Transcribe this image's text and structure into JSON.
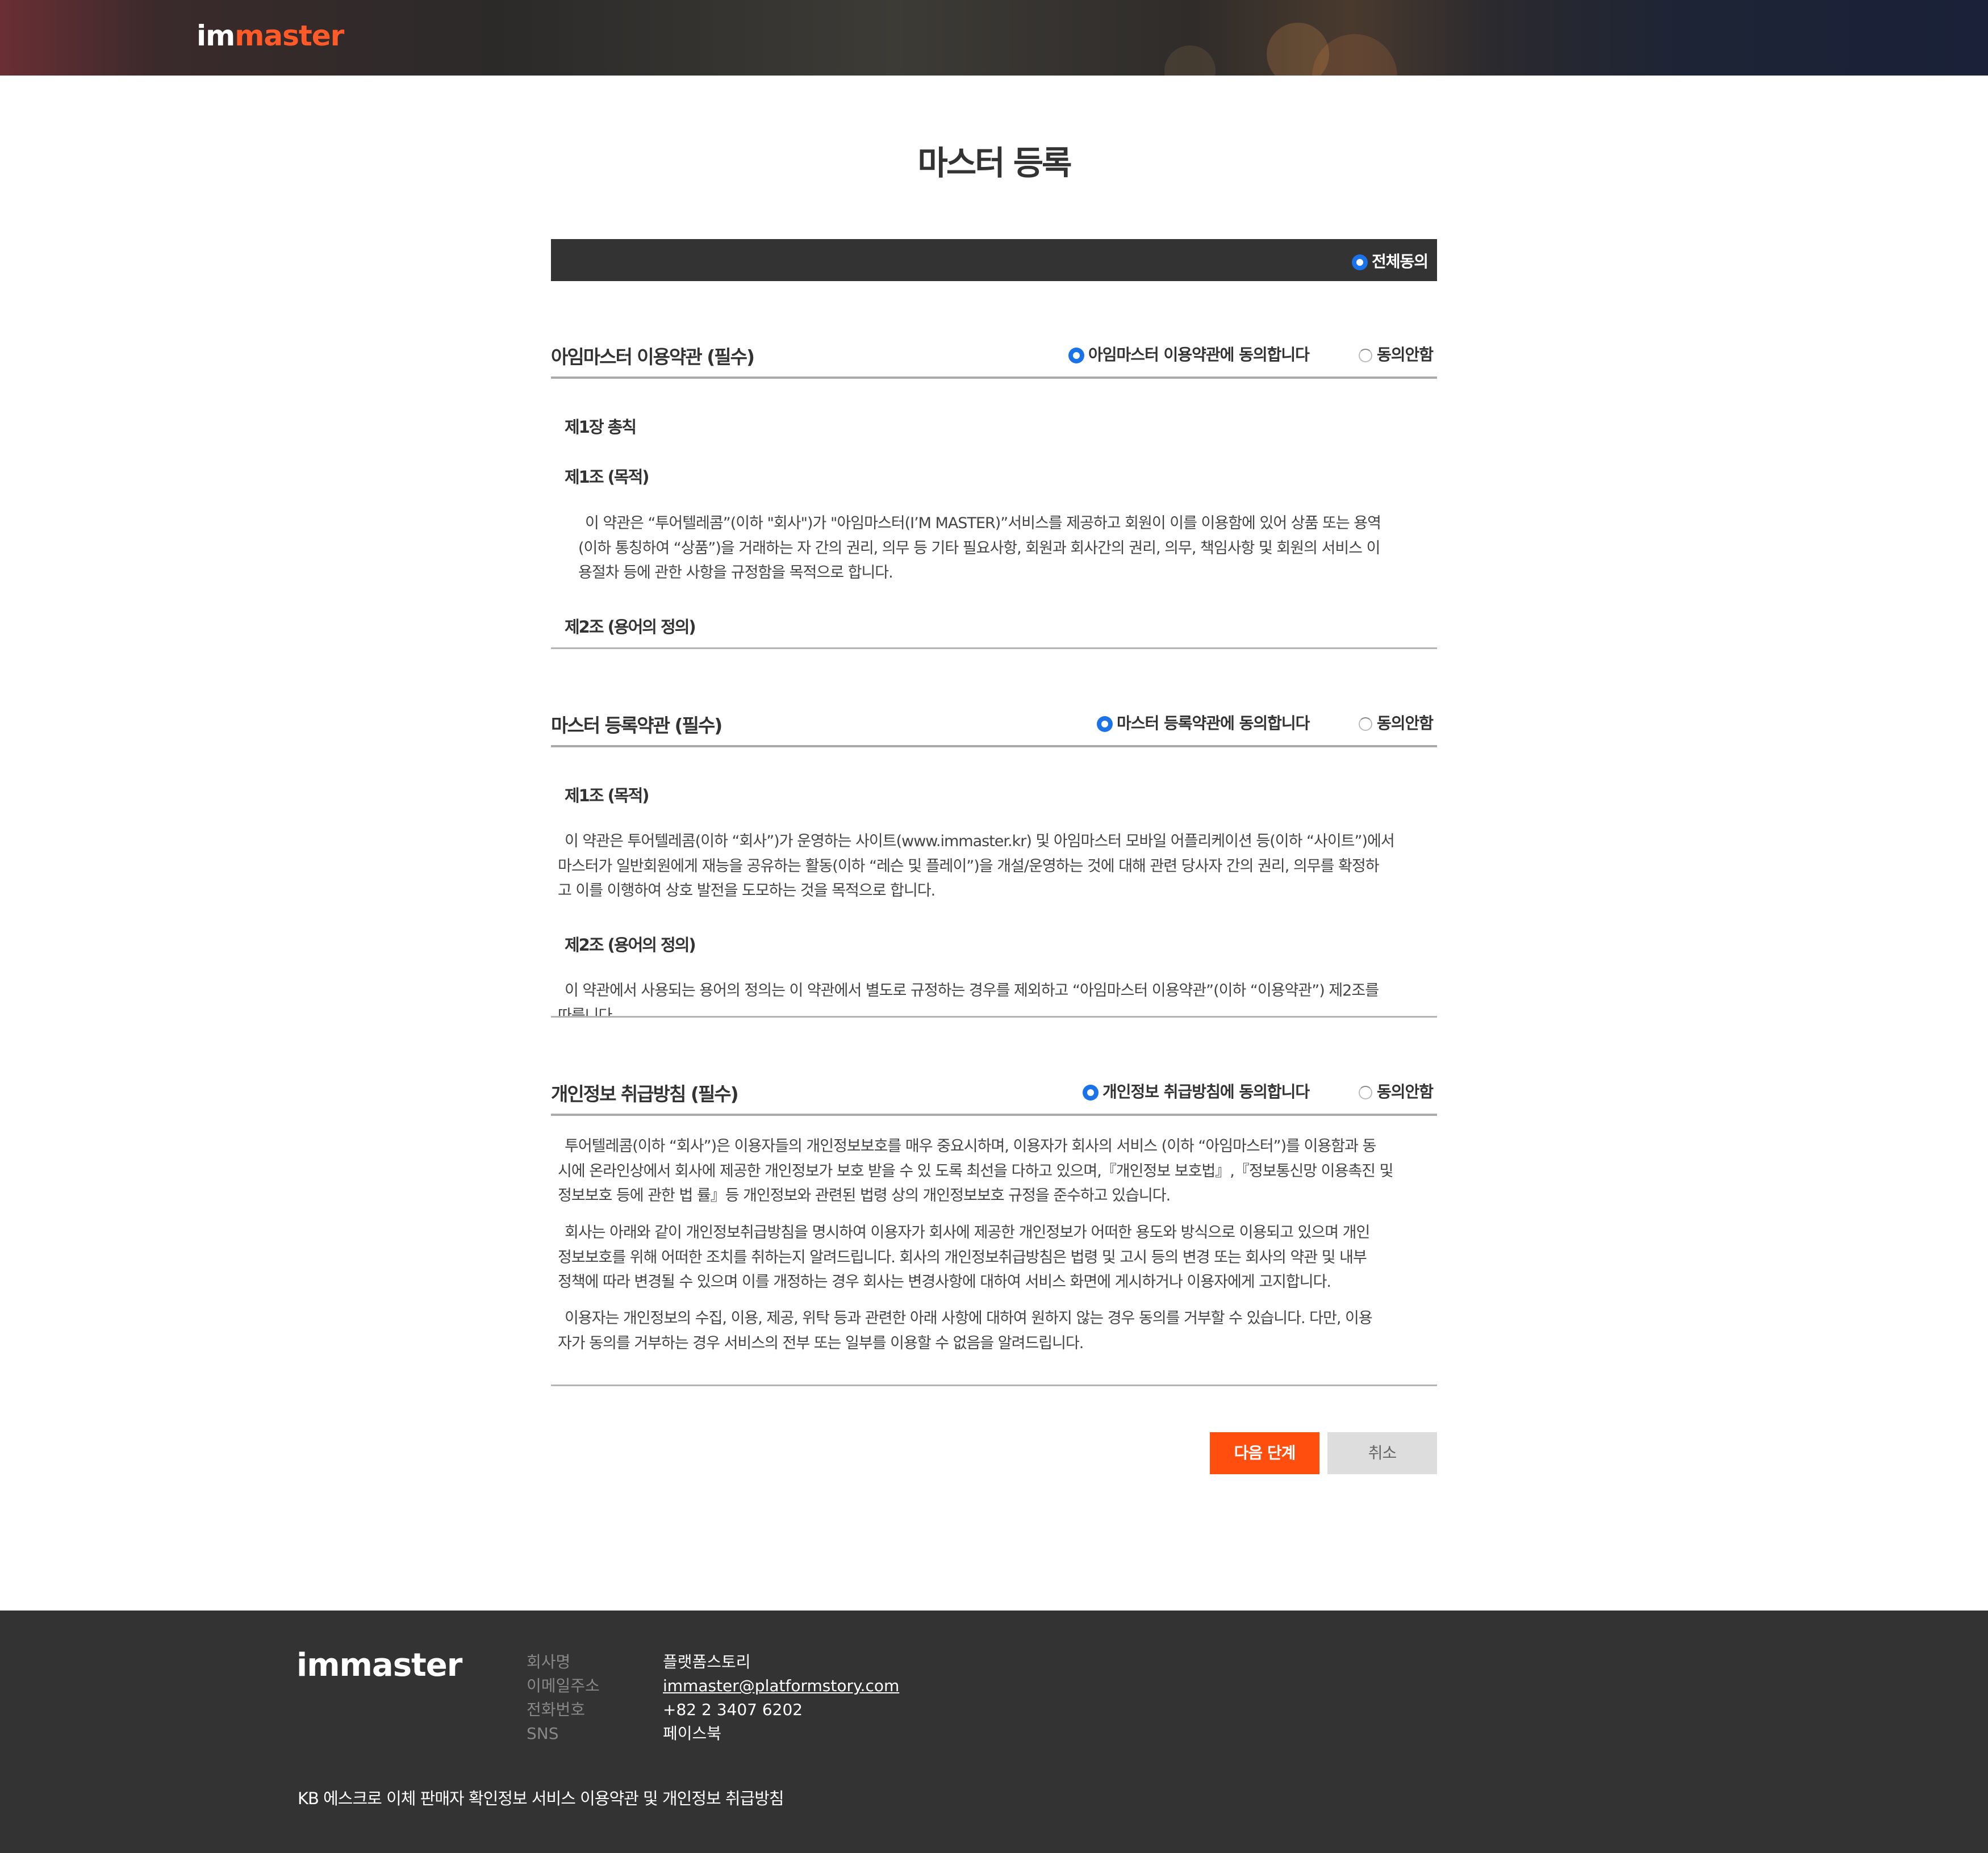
{
  "brand": {
    "logo_a": "im",
    "logo_b": "master",
    "footer_logo": "immaster"
  },
  "page_title": "마스터 등록",
  "agree_all_label": "전체동의",
  "sections": [
    {
      "title": "아임마스터 이용약관 (필수)",
      "agree_label": "아임마스터 이용약관에 동의합니다",
      "disagree_label": "동의안함",
      "h1": "제1장 총칙",
      "h2": "제1조 (목적)",
      "p1_l1": "이 약관은 “투어텔레콤”(이하 \"회사\")가 \"아임마스터(I’M MASTER)”서비스를 제공하고 회원이 이를 이용함에 있어 상품 또는 용역",
      "p1_l2": "(이하 통칭하여 “상품”)을 거래하는 자 간의 권리, 의무 등 기타 필요사항, 회원과 회사간의 권리, 의무, 책임사항 및 회원의 서비스 이",
      "p1_l3": "용절차 등에 관한 사항을 규정함을 목적으로 합니다.",
      "h3": "제2조 (용어의 정의)"
    },
    {
      "title": "마스터 등록약관 (필수)",
      "agree_label": "마스터 등록약관에 동의합니다",
      "disagree_label": "동의안함",
      "h1": "제1조 (목적)",
      "p1_l1": "이 약관은 투어텔레콤(이하 “회사”)가 운영하는 사이트(www.immaster.kr) 및 아임마스터 모바일 어플리케이션 등(이하 “사이트”)에서",
      "p1_l2": "마스터가 일반회원에게 재능을 공유하는 활동(이하 “레슨 및 플레이”)을 개설/운영하는 것에 대해 관련 당사자 간의 권리, 의무를 확정하",
      "p1_l3": "고 이를 이행하여 상호 발전을 도모하는 것을 목적으로 합니다.",
      "h2": "제2조 (용어의 정의)",
      "p2_l1": "이 약관에서 사용되는 용어의 정의는 이 약관에서 별도로 규정하는 경우를 제외하고 “아임마스터 이용약관”(이하 “이용약관”) 제2조를",
      "p2_l2": "따릅니다."
    },
    {
      "title": "개인정보 취급방침 (필수)",
      "agree_label": "개인정보 취급방침에 동의합니다",
      "disagree_label": "동의안함",
      "p1_l1": "투어텔레콤(이하 “회사”)은 이용자들의 개인정보보호를 매우 중요시하며, 이용자가 회사의 서비스 (이하 “아임마스터”)를 이용함과 동",
      "p1_l2": "시에 온라인상에서 회사에 제공한 개인정보가 보호 받을 수 있 도록 최선을 다하고 있으며,『개인정보 보호법』,『정보통신망 이용촉진 및",
      "p1_l3": "정보보호 등에 관한 법 률』등 개인정보와 관련된 법령 상의 개인정보보호 규정을 준수하고 있습니다.",
      "p2_l1": "회사는 아래와 같이 개인정보취급방침을 명시하여 이용자가 회사에 제공한 개인정보가 어떠한 용도와 방식으로 이용되고 있으며 개인",
      "p2_l2": "정보보호를 위해 어떠한 조치를 취하는지 알려드립니다. 회사의 개인정보취급방침은 법령 및 고시 등의 변경 또는 회사의 약관 및 내부",
      "p2_l3": "정책에 따라 변경될 수 있으며 이를 개정하는 경우 회사는 변경사항에 대하여 서비스 화면에 게시하거나 이용자에게 고지합니다.",
      "p3_l1": "이용자는 개인정보의 수집, 이용, 제공, 위탁 등과 관련한 아래 사항에 대하여 원하지 않는 경우 동의를 거부할 수 있습니다. 다만, 이용",
      "p3_l2": "자가 동의를 거부하는 경우 서비스의 전부 또는 일부를 이용할 수 없음을 알려드립니다."
    }
  ],
  "buttons": {
    "next": "다음 단계",
    "cancel": "취소"
  },
  "footer": {
    "company_label": "회사명",
    "company": "플랫폼스토리",
    "email_label": "이메일주소",
    "email": "immaster@platformstory.com",
    "phone_label": "전화번호",
    "phone": "+82 2 3407 6202",
    "sns_label": "SNS",
    "sns": "페이스북",
    "bottom_text": "KB 에스크로 이체 판매자 확인정보 서비스 이용약관 및 개인정보 취급방침"
  },
  "colors": {
    "accent": "#ff4e0e",
    "radio": "#1a73e8",
    "dark_bar": "#333333"
  }
}
